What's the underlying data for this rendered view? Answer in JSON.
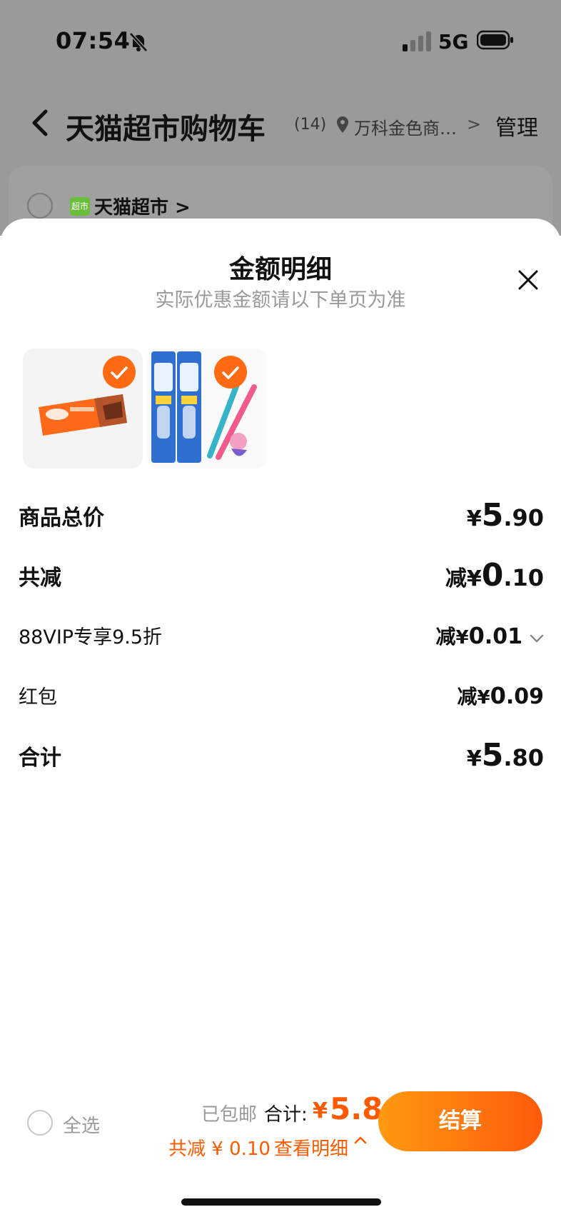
{
  "status_bar": {
    "time": "07:54",
    "network": "5G"
  },
  "nav": {
    "title": "天猫超市购物车",
    "count": "(14)",
    "address": "万科金色商…",
    "manage": "管理"
  },
  "store": {
    "logo": "超市",
    "name": "天猫超市 >"
  },
  "sheet": {
    "title": "金额明细",
    "subtitle": "实际优惠金额请以下单页为准",
    "rows": [
      {
        "label": "商品总价",
        "prefix": "",
        "yen": "¥",
        "int": "5",
        "dec": ".90"
      },
      {
        "label": "共减",
        "prefix": "减",
        "yen": "¥",
        "int": "0",
        "dec": ".10"
      },
      {
        "label": "88VIP专享9.5折",
        "prefix": "减",
        "yen": "¥",
        "int": "0",
        "dec": ".01"
      },
      {
        "label": "红包",
        "prefix": "减",
        "yen": "¥",
        "int": "0",
        "dec": ".09"
      },
      {
        "label": "合计",
        "prefix": "",
        "yen": "¥",
        "int": "5",
        "dec": ".80"
      }
    ]
  },
  "footer": {
    "select_all": "全选",
    "shipping": "已包邮",
    "total_label": "合计:",
    "yen": "¥",
    "total": "5.8",
    "discount": "共减 ¥ 0.10",
    "view_detail": "查看明细",
    "checkout": "结算"
  },
  "icons": {
    "back": "chevron-left-icon",
    "location": "location-pin-icon",
    "close": "close-icon",
    "check": "checkmark-icon",
    "expand": "chevron-down-icon",
    "collapse": "chevron-up-icon"
  },
  "colors": {
    "accent": "#ff5a00",
    "checkout_start": "#ff9a12",
    "checkout_end": "#ff5a0a",
    "overlay": "#9a9a9a"
  }
}
